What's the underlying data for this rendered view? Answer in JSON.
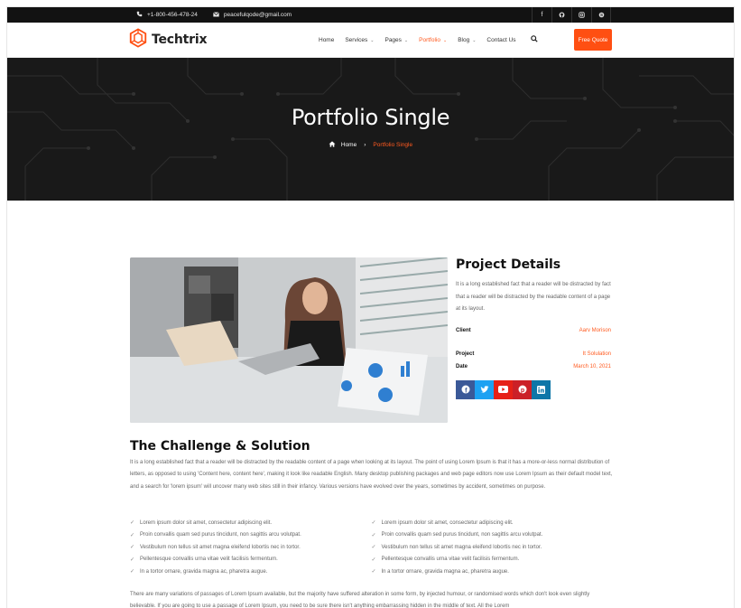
{
  "topbar": {
    "phone": "+1-800-456-478-24",
    "email": "peacefulqode@gmail.com",
    "social_icons": [
      "facebook-icon",
      "github-icon",
      "instagram-icon",
      "skype-icon"
    ]
  },
  "nav": {
    "brand": "Techtrix",
    "menu": [
      {
        "label": "Home",
        "dropdown": false,
        "active": false
      },
      {
        "label": "Services",
        "dropdown": true,
        "active": false
      },
      {
        "label": "Pages",
        "dropdown": true,
        "active": false
      },
      {
        "label": "Portfolio",
        "dropdown": true,
        "active": true
      },
      {
        "label": "Blog",
        "dropdown": true,
        "active": false
      },
      {
        "label": "Contact Us",
        "dropdown": false,
        "active": false
      }
    ],
    "cta": "Free Quote"
  },
  "hero": {
    "title": "Portfolio Single",
    "crumb_home": "Home",
    "crumb_current": "Portfolio Single"
  },
  "project": {
    "heading": "Project Details",
    "description": "It is a long established fact that a reader will be distracted by fact that a reader will be distracted by the readable content of a page at its layout.",
    "client_label": "Client",
    "client_value": "Aarv Morison",
    "project_label": "Project",
    "project_value": "It Solulation",
    "date_label": "Date",
    "date_value": "March 10, 2021",
    "share": [
      "facebook-icon",
      "twitter-icon",
      "youtube-icon",
      "pinterest-icon",
      "linkedin-icon"
    ]
  },
  "challenge": {
    "heading": "The Challenge & Solution",
    "text": "It is a long established fact that a reader will be distracted by the readable content of a page when looking at its layout. The point of using Lorem Ipsum is that it has a more-or-less normal distribution of letters, as opposed to using 'Content here, content here', making it look like readable English. Many desktop publishing packages and web page editors now use Lorem Ipsum as their default model text, and a search for 'lorem ipsum' will uncover many web sites still in their infancy. Various versions have evolved over the years, sometimes by accident, sometimes on purpose.",
    "list_left": [
      "Lorem ipsum dolor sit amet, consectetur adipiscing elit.",
      "Proin convallis quam sed purus tincidunt, non sagittis arcu volutpat.",
      "Vestibulum non tellus sit amet magna eleifend lobortis nec in tortor.",
      "Pellentesque convallis urna vitae velit facilisis fermentum.",
      "In a tortor ornare, gravida magna ac, pharetra augue."
    ],
    "list_right": [
      "Lorem ipsum dolor sit amet, consectetur adipiscing elit.",
      "Proin convallis quam sed purus tincidunt, non sagittis arcu volutpat.",
      "Vestibulum non tellus sit amet magna eleifend lobortis nec in tortor.",
      "Pellentesque convallis urna vitae velit facilisis fermentum.",
      "In a tortor ornare, gravida magna ac, pharetra augue."
    ],
    "more_text": "There are many variations of passages of Lorem Ipsum available, but the majority have suffered alteration in some form, by injected humour, or randomised words which don't look even slightly believable. If you are going to use a passage of Lorem Ipsum, you need to be sure there isn't anything embarrassing hidden in the middle of text. All the Lorem"
  },
  "colors": {
    "accent": "#ff4f12",
    "dark": "#121212",
    "facebook": "#3b5998",
    "twitter": "#1da1f2",
    "youtube": "#e62117",
    "pinterest": "#cb2027",
    "linkedin": "#0e76a8"
  }
}
